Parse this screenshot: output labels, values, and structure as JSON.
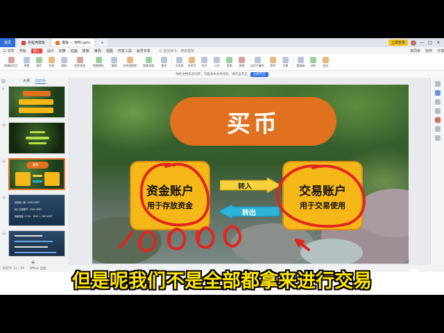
{
  "titlebar": {
    "app_label": "首页",
    "tabs": [
      {
        "label": "找稻壳模板",
        "icon": "wps-red-icon"
      },
      {
        "label": "模板 — 架构.pptx",
        "icon": "ppt-orange-icon"
      }
    ],
    "login_label": "立即登录",
    "window_controls": [
      "—",
      "□",
      "✕"
    ]
  },
  "menubar": {
    "items": [
      "三 文件",
      "开始",
      "插入",
      "设计",
      "切换",
      "动画",
      "放映",
      "审阅",
      "视图",
      "开发工具",
      "会员专享"
    ],
    "active_index": 2,
    "search_placeholder": "Q 查找命令、搜索模板",
    "right_items": [
      "未同步",
      "协作",
      "分享"
    ]
  },
  "ribbon": {
    "groups": [
      [
        "新建幻灯片",
        "表格",
        "图片",
        "形状",
        "图标",
        "稻壳资源",
        "智能图形",
        "截屏",
        "在线流程图",
        "思维导图",
        "更多"
      ],
      [
        "文本框",
        "艺术字",
        "符号",
        "公式",
        "音频",
        "视频",
        "幻灯片编号",
        "附件",
        "对象"
      ],
      [
        "超链接",
        "动作",
        "批注"
      ]
    ]
  },
  "notice": {
    "text": "你的文档未云同步，可能丢失文件资料，请点击开启",
    "button": "立即开启"
  },
  "leftpanel": {
    "tabs": [
      "大纲",
      "幻灯片"
    ],
    "active_tab": 1,
    "slides": [
      {
        "num": "9"
      },
      {
        "num": "10"
      },
      {
        "num": "11",
        "title": "买币"
      },
      {
        "num": "12",
        "lines": [
          "总投资入账: 1000 USDT",
          "转入交易账户: 1100 USDT",
          "保留资金: 1700 - 1000 = 300 USDT"
        ]
      },
      {
        "num": "13"
      }
    ],
    "add_label": "+"
  },
  "statusbar": {
    "slide_info": "幻灯片 11 / 19",
    "theme": "Office 主题"
  },
  "slide": {
    "title": "买币",
    "left_account": {
      "name": "资金账户",
      "desc": "用于存放资金"
    },
    "right_account": {
      "name": "交易账户",
      "desc": "用于交易使用"
    },
    "arrow_in_label": "转入",
    "arrow_out_label": "转出"
  },
  "subtitle": {
    "text": "但是呢我们不是全部都拿来进行交易"
  },
  "colors": {
    "accent_orange": "#e0711f",
    "account_yellow": "#f6b819",
    "annotation_red": "#e0261f",
    "subtitle_yellow": "#ffe600",
    "wps_blue": "#2f6fdd"
  }
}
